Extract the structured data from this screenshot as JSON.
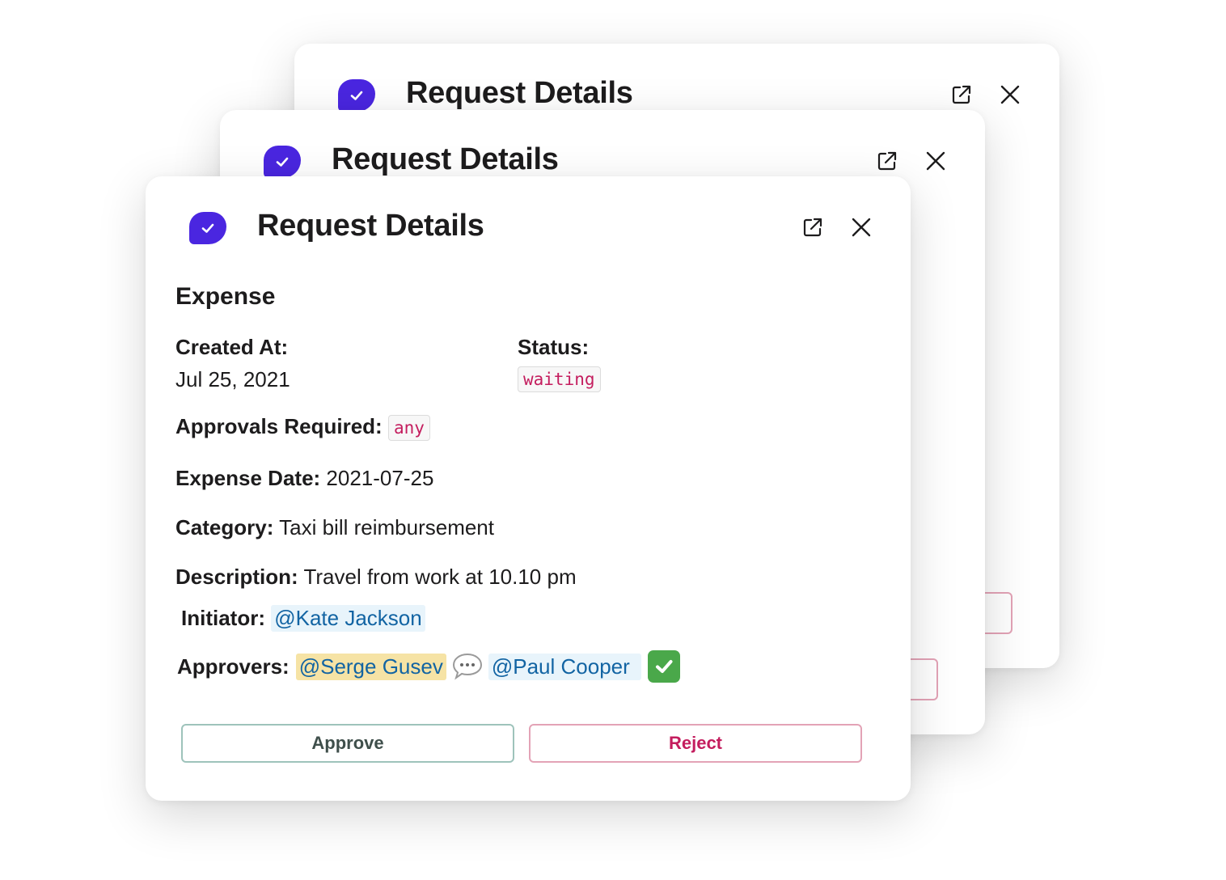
{
  "modal": {
    "title": "Request Details",
    "app_icon": "check-bubble-icon",
    "external_link_icon": "external-link-icon",
    "close_icon": "close-icon",
    "accent_color": "#4a26e0"
  },
  "request": {
    "section_title": "Expense",
    "created_at_label": "Created At:",
    "created_at_value": "Jul 25, 2021",
    "status_label": "Status:",
    "status_value": "waiting",
    "approvals_required_label": "Approvals Required:",
    "approvals_required_value": "any",
    "expense_date_label": "Expense Date:",
    "expense_date_value": "2021-07-25",
    "category_label": "Category:",
    "category_value": "Taxi bill reimbursement",
    "description_label": "Description:",
    "description_value": "Travel from work at 10.10 pm",
    "initiator_label": "Initiator:",
    "initiator_value": "@Kate Jackson",
    "approvers_label": "Approvers:",
    "approvers": [
      {
        "name": "@Serge Gusev",
        "status_icon": "speech-bubble-icon",
        "highlight": true
      },
      {
        "name": "@Paul Cooper",
        "status_icon": "white-check-mark-icon",
        "highlight": false
      }
    ]
  },
  "actions": {
    "approve_label": "Approve",
    "reject_label": "Reject"
  }
}
